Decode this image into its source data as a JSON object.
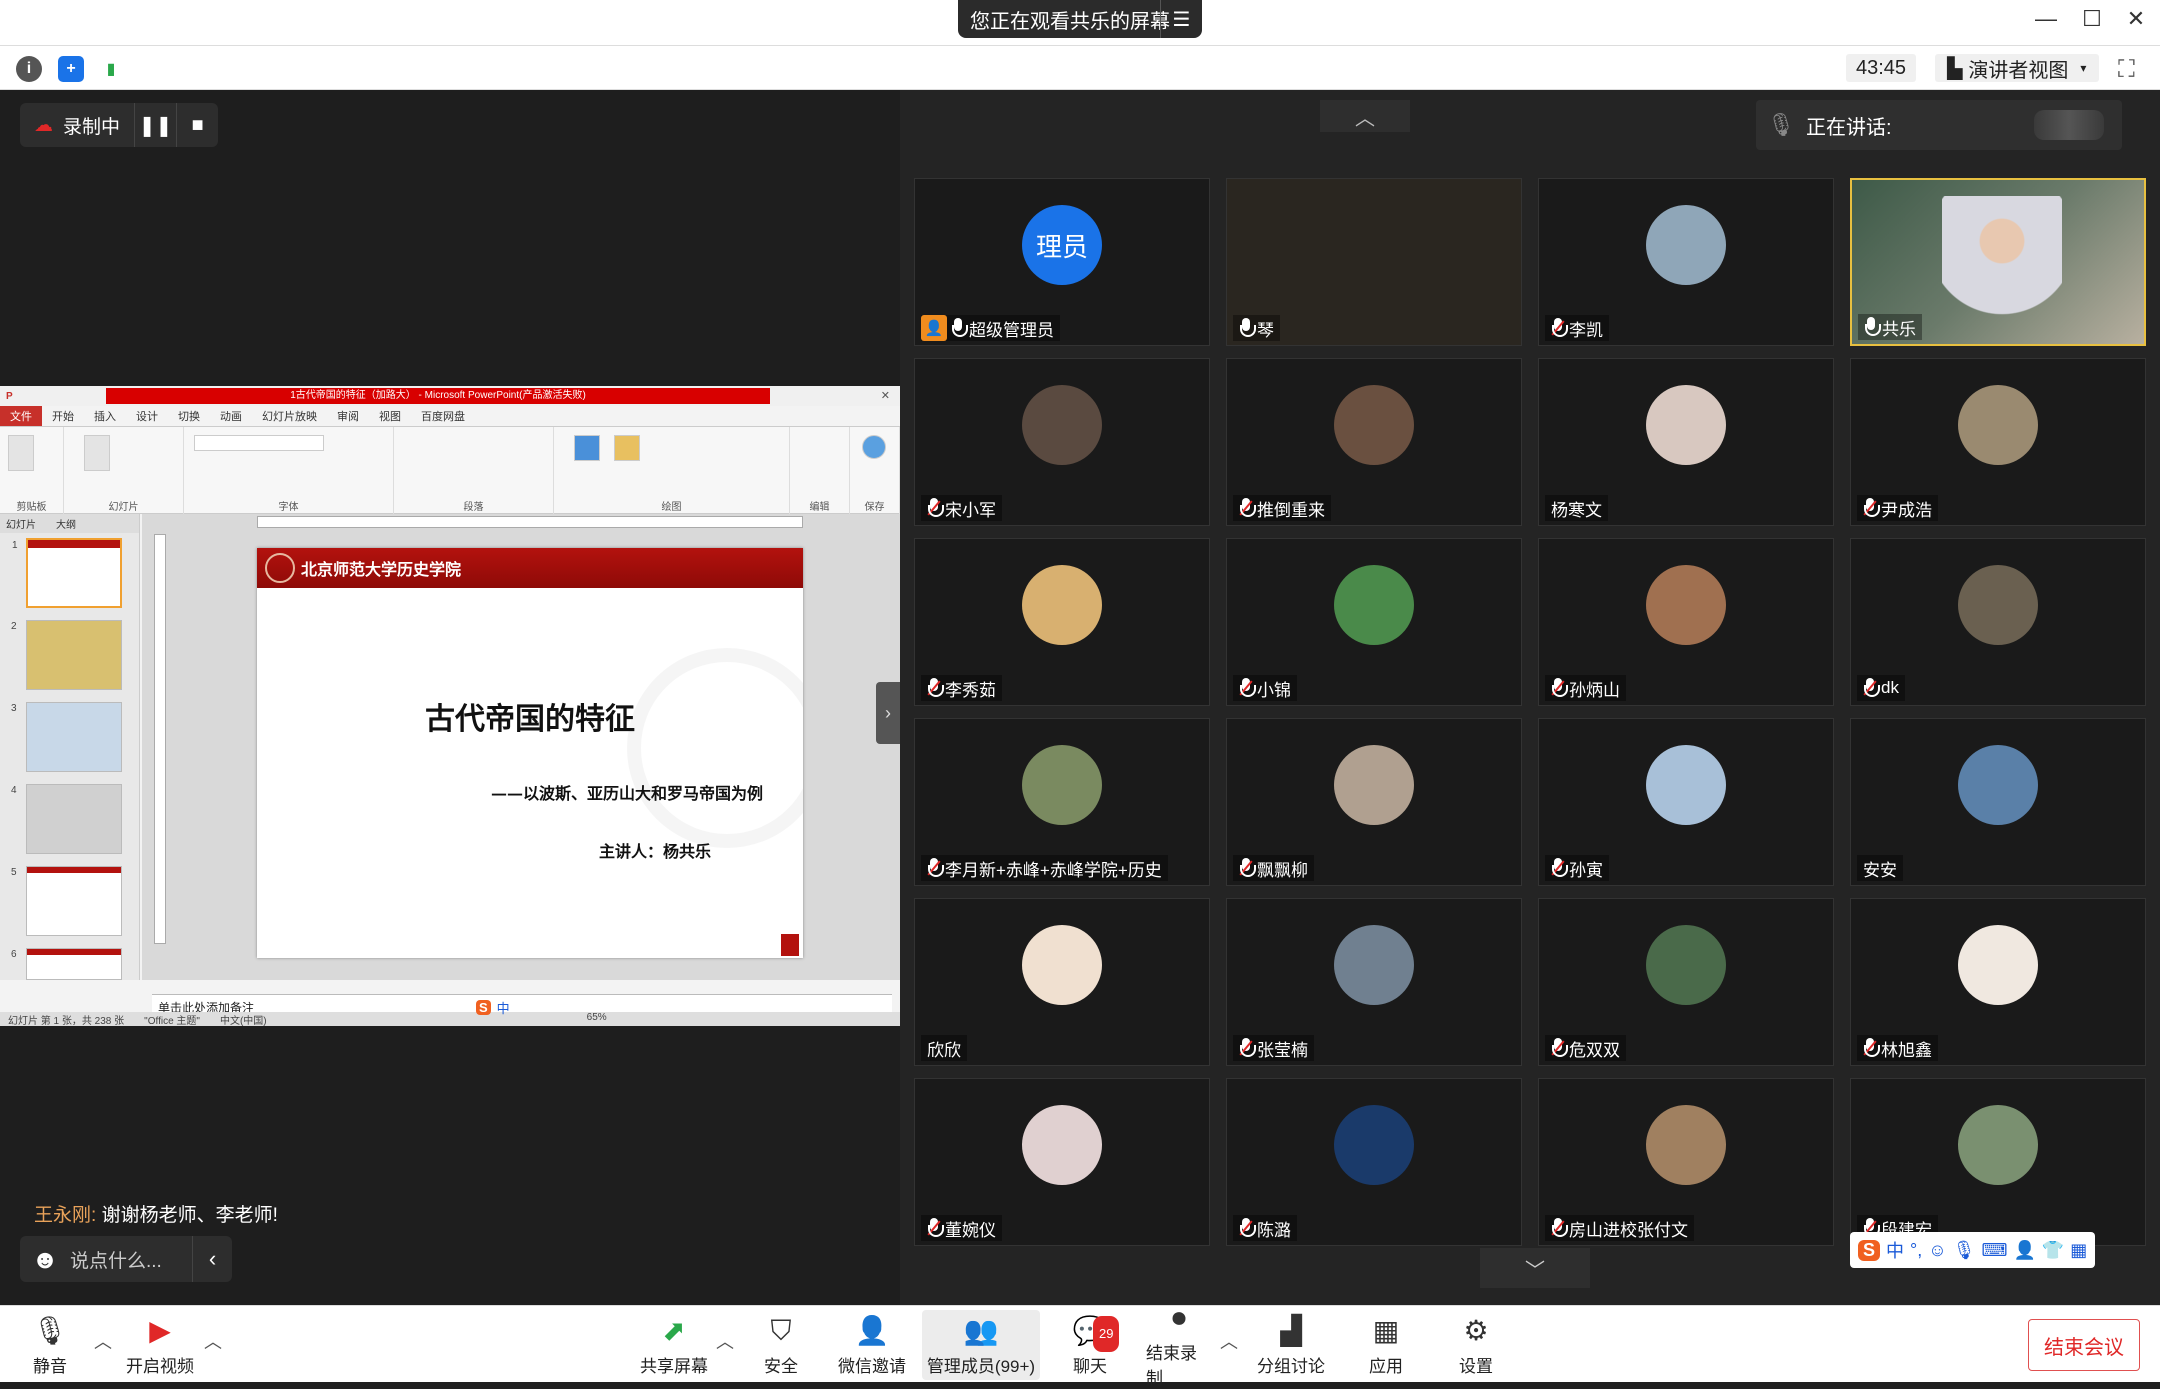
{
  "banner": {
    "text": "您正在观看共乐的屏幕",
    "menu_icon": "menu-icon"
  },
  "window": {
    "min": "—",
    "max": "☐",
    "close": "✕"
  },
  "toolbar": {
    "timer": "43:45",
    "view_label": "演讲者视图",
    "fullscreen": "⛶"
  },
  "recording": {
    "label": "录制中",
    "pause": "❚❚",
    "stop": "■"
  },
  "ppt": {
    "title": "1古代帝国的特征（加路大）  -  Microsoft PowerPoint(产品激活失败)",
    "tabs": [
      "文件",
      "开始",
      "插入",
      "设计",
      "切换",
      "动画",
      "幻灯片放映",
      "审阅",
      "视图",
      "百度网盘"
    ],
    "groups": [
      "剪贴板",
      "幻灯片",
      "字体",
      "段落",
      "绘图",
      "编辑",
      "保存"
    ],
    "panel_tabs": [
      "幻灯片",
      "大纲"
    ],
    "thumb_numbers": [
      "1",
      "2",
      "3",
      "4",
      "5",
      "6"
    ],
    "slide": {
      "header": "北京师范大学历史学院",
      "title": "古代帝国的特征",
      "subtitle": "——以波斯、亚历山大和罗马帝国为例",
      "speaker": "主讲人：杨共乐"
    },
    "notes": "单击此处添加备注",
    "status": [
      "幻灯片 第 1 张，共 238 张",
      "\"Office 主题\"",
      "中文(中国)"
    ],
    "zoom": "65%"
  },
  "chat": {
    "sender": "王永刚:",
    "message": "谢谢杨老师、李老师!",
    "placeholder": "说点什么..."
  },
  "speaking": {
    "label": "正在讲话:"
  },
  "participants": [
    {
      "name": "超级管理员",
      "avatar_text": "理员",
      "mic": "on",
      "host": true,
      "avatar_color": "#1a73e8"
    },
    {
      "name": "琴",
      "mic": "on",
      "avatar_color": "#2a2620"
    },
    {
      "name": "李凯",
      "mic": "muted",
      "avatar_color": "#8fa6b8"
    },
    {
      "name": "共乐",
      "mic": "on",
      "avatar_color": "#5a7060",
      "video": true
    },
    {
      "name": "宋小军",
      "mic": "muted",
      "avatar_color": "#5a4a40"
    },
    {
      "name": "推倒重来",
      "mic": "muted",
      "avatar_color": "#6a5040"
    },
    {
      "name": "杨寒文",
      "mic": "none",
      "avatar_color": "#d8c8c0"
    },
    {
      "name": "尹成浩",
      "mic": "muted",
      "avatar_color": "#9a8a70"
    },
    {
      "name": "李秀茹",
      "mic": "muted",
      "avatar_color": "#d8b070"
    },
    {
      "name": "小锦",
      "mic": "muted",
      "avatar_color": "#4a8a4a"
    },
    {
      "name": "孙炳山",
      "mic": "muted",
      "avatar_color": "#a07050"
    },
    {
      "name": "dk",
      "mic": "muted",
      "avatar_color": "#6a6050"
    },
    {
      "name": "李月新+赤峰+赤峰学院+历史",
      "mic": "muted",
      "avatar_color": "#7a8a60"
    },
    {
      "name": "飘飘柳",
      "mic": "muted",
      "avatar_color": "#b0a090"
    },
    {
      "name": "孙寅",
      "mic": "muted",
      "avatar_color": "#a8c0d8"
    },
    {
      "name": "安安",
      "mic": "none",
      "avatar_color": "#5a80a8"
    },
    {
      "name": "欣欣",
      "mic": "none",
      "avatar_color": "#f0e0d0"
    },
    {
      "name": "张莹楠",
      "mic": "muted",
      "avatar_color": "#708090"
    },
    {
      "name": "危双双",
      "mic": "muted",
      "avatar_color": "#4a6a4a"
    },
    {
      "name": "林旭鑫",
      "mic": "muted",
      "avatar_color": "#f0e8e0"
    },
    {
      "name": "董婉仪",
      "mic": "muted",
      "avatar_color": "#e0d0d0"
    },
    {
      "name": "陈潞",
      "mic": "muted",
      "avatar_color": "#1a3a6a"
    },
    {
      "name": "房山进校张付文",
      "mic": "muted",
      "avatar_color": "#a08060"
    },
    {
      "name": "段建宏",
      "mic": "muted",
      "avatar_color": "#7a9070"
    }
  ],
  "bottom": {
    "mute": "静音",
    "video": "开启视频",
    "share": "共享屏幕",
    "security": "安全",
    "invite": "微信邀请",
    "manage": "管理成员(99+)",
    "chat": "聊天",
    "chat_badge": "29",
    "end_rec": "结束录制",
    "breakout": "分组讨论",
    "apps": "应用",
    "settings": "设置",
    "end": "结束会议"
  },
  "ime": {
    "lang": "中"
  }
}
